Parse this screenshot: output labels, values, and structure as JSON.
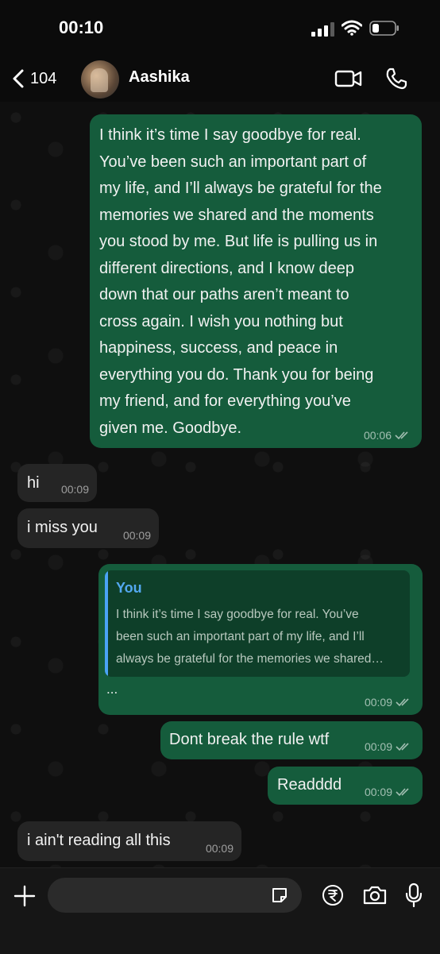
{
  "status_bar": {
    "time": "00:10"
  },
  "header": {
    "back_count": "104",
    "contact_name": "Aashika"
  },
  "messages": {
    "m1": {
      "lines": [
        "I think it’s time I say goodbye for real.",
        "You’ve been such an important part of",
        "my life, and I’ll always be grateful for the",
        "memories we shared and the moments",
        "you stood by me. But life is pulling us in",
        "different directions, and I know deep",
        "down that our paths aren’t meant to",
        "cross again. I wish you nothing but",
        "happiness, success, and peace in",
        "everything you do. Thank you for being",
        "my friend, and for everything you’ve",
        "given me. Goodbye."
      ],
      "time": "00:06"
    },
    "m2": {
      "text": "hi",
      "time": "00:09"
    },
    "m3": {
      "text": "i miss you",
      "time": "00:09"
    },
    "m4": {
      "quote_author": "You",
      "quote_lines": [
        "I think it’s time I say goodbye for real. You’ve",
        "been such an important part of my life, and I’ll",
        "always be grateful for the memories we shared…"
      ],
      "text": "...",
      "time": "00:09"
    },
    "m5": {
      "text": "Dont break the rule wtf",
      "time": "00:09"
    },
    "m6": {
      "text": "Readddd",
      "time": "00:09"
    },
    "m7": {
      "text": "i ain't reading all this",
      "time": "00:09"
    }
  },
  "icons": {
    "back": "chevron-left-icon",
    "video": "video-call-icon",
    "call": "phone-icon",
    "plus": "plus-icon",
    "sticker": "sticker-icon",
    "payment": "rupee-icon",
    "camera": "camera-icon",
    "mic": "microphone-icon"
  },
  "colors": {
    "outgoing_bubble": "#155c3c",
    "incoming_bubble": "#252525",
    "quote_accent": "#4aa3f5"
  }
}
